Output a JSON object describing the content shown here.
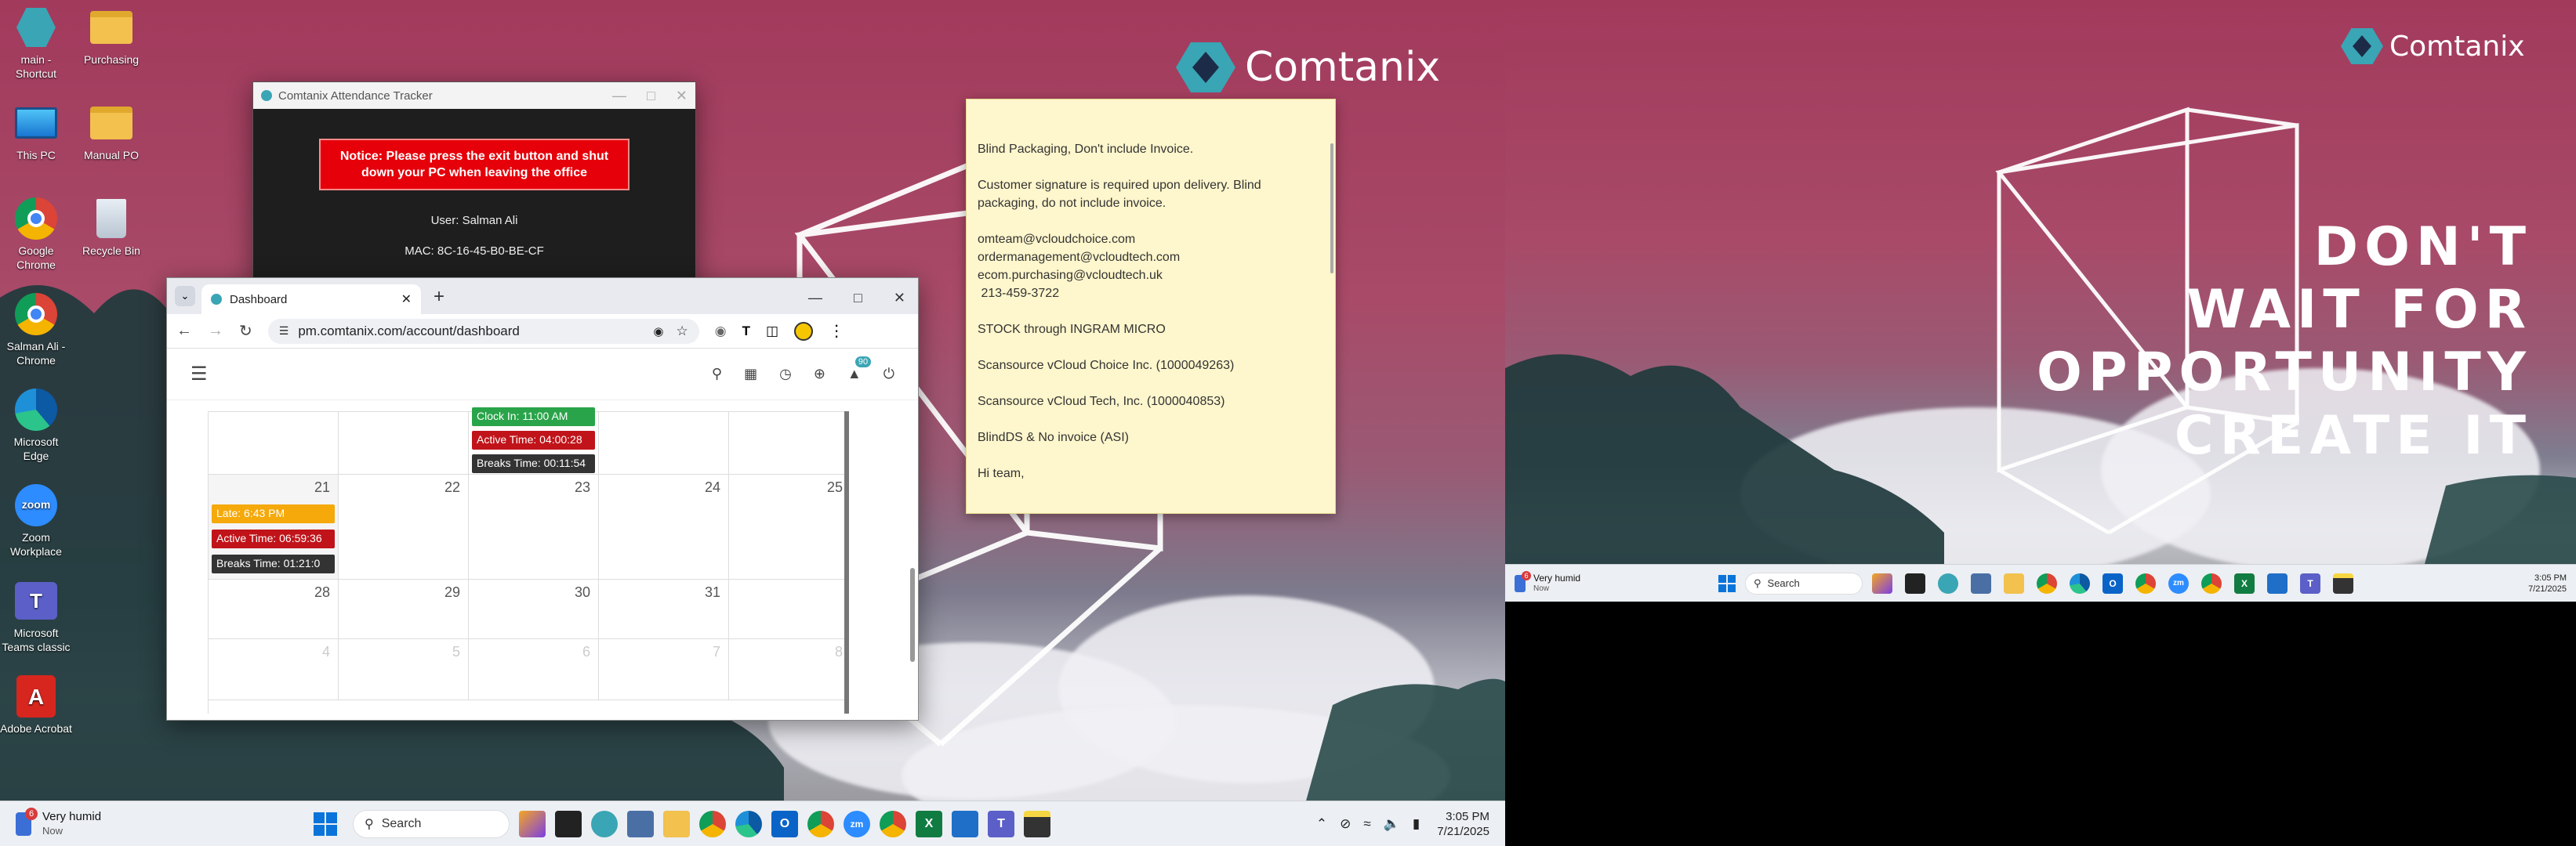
{
  "wallpaper": {
    "brand": "Comtanix",
    "slogan": [
      "DON'T",
      "WAIT FOR",
      "OPPORTUNITY",
      "CREATE IT"
    ]
  },
  "desktop_icons": [
    {
      "label": "main - Shortcut",
      "icon": "app-shortcut-icon"
    },
    {
      "label": "Purchasing",
      "icon": "folder-icon"
    },
    {
      "label": "This PC",
      "icon": "monitor-icon"
    },
    {
      "label": "Manual PO",
      "icon": "folder-icon"
    },
    {
      "label": "Google Chrome",
      "icon": "chrome-icon"
    },
    {
      "label": "Recycle Bin",
      "icon": "recycle-bin-icon"
    },
    {
      "label": "Salman Ali - Chrome",
      "icon": "chrome-icon"
    },
    {
      "label": "Microsoft Edge",
      "icon": "edge-icon"
    },
    {
      "label": "Zoom Workplace",
      "icon": "zoom-icon"
    },
    {
      "label": "Microsoft Teams classic",
      "icon": "teams-icon"
    },
    {
      "label": "Adobe Acrobat",
      "icon": "acrobat-icon"
    }
  ],
  "attendance_tracker": {
    "title": "Comtanix Attendance Tracker",
    "notice": "Notice: Please press the exit button and shut down your PC when leaving the office",
    "user": "User: Salman Ali",
    "mac": "MAC: 8C-16-45-B0-BE-CF"
  },
  "browser": {
    "tab_title": "Dashboard",
    "url": "pm.comtanix.com/account/dashboard",
    "notification_count": "90",
    "calendar": {
      "partial_row": {
        "chips": [
          "Clock In: 11:00 AM",
          "Active Time: 04:00:28",
          "Breaks Time: 00:11:54"
        ]
      },
      "week_rows": [
        [
          "21",
          "22",
          "23",
          "24",
          "25"
        ],
        [
          "28",
          "29",
          "30",
          "31",
          ""
        ],
        [
          "4",
          "5",
          "6",
          "7",
          "8"
        ]
      ],
      "day21_chips": [
        "Late: 6:43 PM",
        "Active Time: 06:59:36",
        "Breaks Time: 01:21:0"
      ],
      "colors": {
        "late": "#f5a90b",
        "active": "#c0141a",
        "breaks": "#333333",
        "clock_in": "#2aa44a"
      }
    }
  },
  "sticky_note": {
    "lines": [
      "Blind Packaging, Don't include Invoice.",
      "",
      "Customer signature is required upon delivery. Blind",
      "packaging, do not include invoice.",
      "",
      "omteam@vcloudchoice.com",
      "ordermanagement@vcloudtech.com",
      "ecom.purchasing@vcloudtech.uk",
      " 213-459-3722",
      "",
      "STOCK through INGRAM MICRO",
      "",
      "Scansource vCloud Choice Inc. (1000049263)",
      "",
      "Scansource vCloud Tech, Inc. (1000040853)",
      "",
      "BlindDS & No invoice (ASI)",
      "",
      "Hi team,"
    ]
  },
  "taskbar": {
    "weather": "Very humid",
    "weather_sub": "Now",
    "weather_badge": "6",
    "search": "Search",
    "time": "3:05 PM",
    "date": "7/21/2025",
    "apps": [
      "widgets-icon",
      "taskview-icon",
      "app-icon",
      "calculator-icon",
      "file-explorer-icon",
      "chrome-icon",
      "edge-icon",
      "outlook-icon",
      "chrome-icon",
      "zoom-icon",
      "chrome-icon",
      "excel-icon",
      "snipping-icon",
      "teams-icon",
      "sticky-notes-icon"
    ]
  }
}
